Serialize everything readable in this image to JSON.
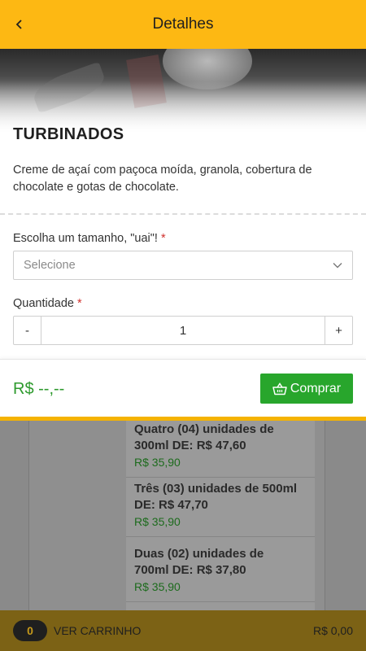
{
  "header": {
    "title": "Detalhes"
  },
  "product": {
    "name": "TURBINADOS",
    "description": "Creme de açaí com paçoca moída, granola, cobertura de chocolate e gotas de chocolate."
  },
  "size": {
    "label": "Escolha um tamanho, \"uai\"!",
    "required_mark": "*",
    "placeholder": "Selecione"
  },
  "quantity": {
    "label": "Quantidade",
    "required_mark": "*",
    "minus": "-",
    "value": "1",
    "plus": "+"
  },
  "footer": {
    "price": "R$ --,--",
    "buy_label": "Comprar"
  },
  "background_items": [
    {
      "title_line1": "Quatro (04) unidades de",
      "title_line2": "300ml DE: R$ 47,60",
      "price": "R$ 35,90"
    },
    {
      "title_line1": "Três (03) unidades de 500ml",
      "title_line2": "DE: R$ 47,70",
      "price": "R$ 35,90"
    },
    {
      "title_line1": "Duas (02) unidades de",
      "title_line2": "700ml DE: R$ 37,80",
      "price": "R$ 35,90"
    }
  ],
  "cart": {
    "count": "0",
    "label": "VER CARRINHO",
    "total": "R$ 0,00"
  },
  "colors": {
    "header": "#fdb813",
    "buy_button": "#28a62c",
    "price": "#2e9a2e",
    "required": "#d0312d"
  },
  "icons": {
    "back": "chevron-left-icon",
    "select": "chevron-down-icon",
    "buy": "basket-icon"
  }
}
